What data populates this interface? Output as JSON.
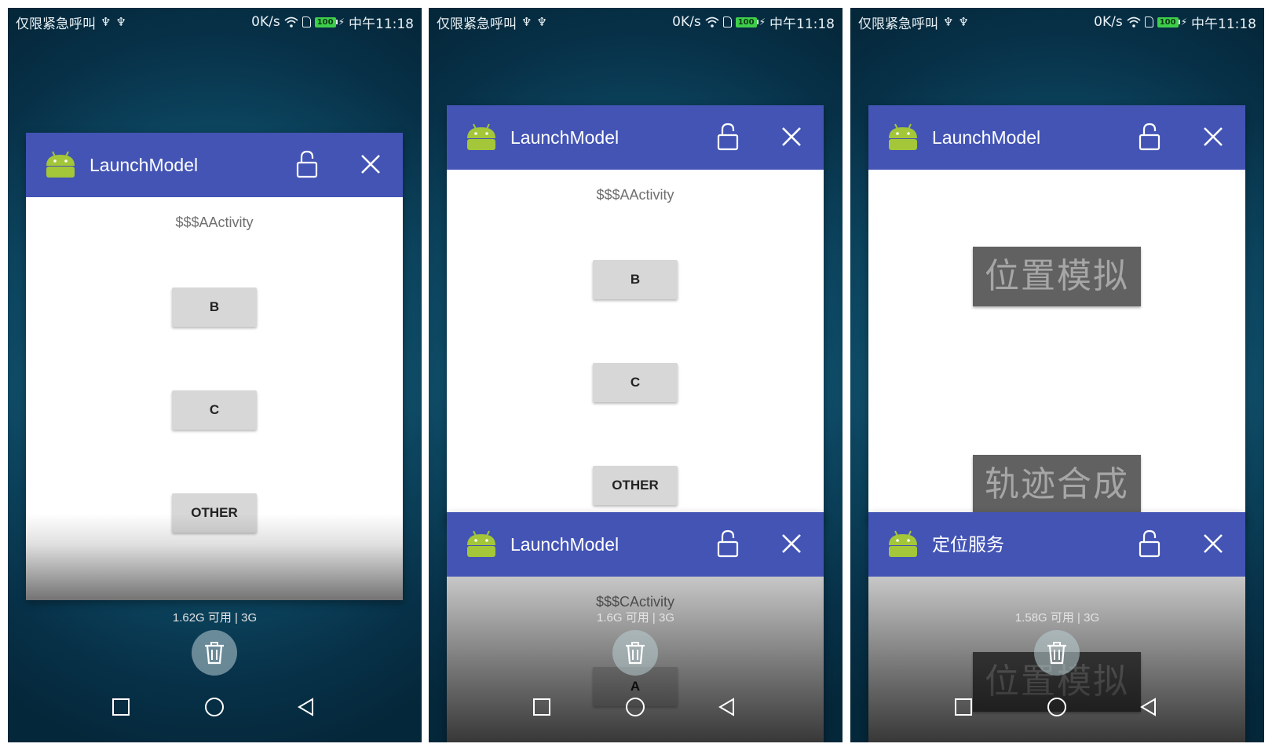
{
  "status_bar": {
    "carrier_text": "仅限紧急呼叫",
    "usb_glyph": "♆",
    "speed": "0K/s",
    "battery": "100",
    "time": "中午11:18"
  },
  "header_icons": [
    "android-icon",
    "unlock-icon",
    "close-icon"
  ],
  "colors": {
    "header": "#4354b5",
    "button": "#d7d7d7",
    "tile": "#616161"
  },
  "screens": [
    {
      "cards": [
        {
          "title": "LaunchModel",
          "activity": "$$$AActivity",
          "buttons": [
            "B",
            "C",
            "OTHER"
          ]
        }
      ],
      "memory": "1.62G 可用 | 3G"
    },
    {
      "cards": [
        {
          "title": "LaunchModel",
          "activity": "$$$AActivity",
          "buttons": [
            "B",
            "C",
            "OTHER"
          ]
        },
        {
          "title": "LaunchModel",
          "activity": "$$$CActivity",
          "buttons": [
            "A"
          ]
        }
      ],
      "memory": "1.6G 可用 | 3G"
    },
    {
      "cards": [
        {
          "title": "LaunchModel",
          "tiles": [
            "位置模拟",
            "轨迹合成"
          ]
        },
        {
          "title": "定位服务",
          "tiles": [
            "位置模拟"
          ]
        }
      ],
      "memory": "1.58G 可用 | 3G"
    }
  ],
  "nav_buttons": [
    "square-icon",
    "circle-icon",
    "triangle-back-icon"
  ]
}
